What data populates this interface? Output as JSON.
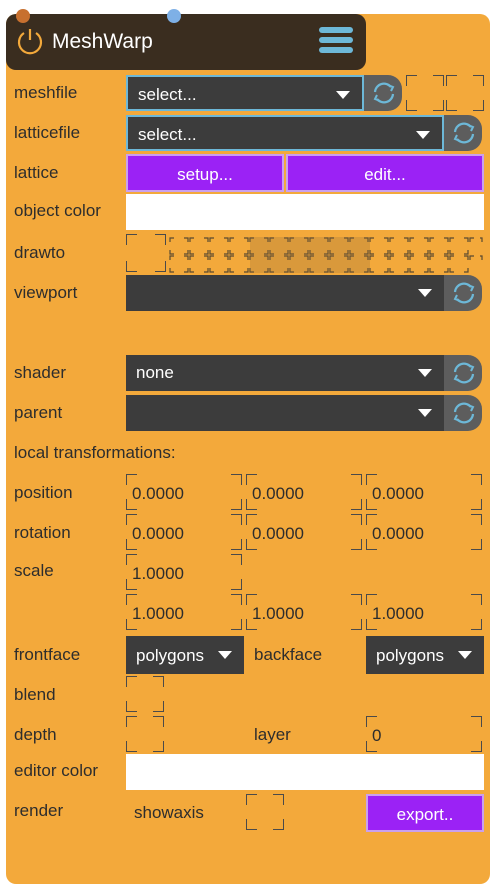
{
  "app": {
    "title": "MeshWarp"
  },
  "colors": {
    "panel": "#f3a93b",
    "titlebar": "#3a2d1f",
    "accent_purple": "#9b22f5",
    "dropdown": "#3c3c3c",
    "refresh_icon": "#6db8d8"
  },
  "rows": {
    "meshfile": {
      "label": "meshfile",
      "value": "select..."
    },
    "latticefile": {
      "label": "latticefile",
      "value": "select..."
    },
    "lattice": {
      "label": "lattice",
      "setup": "setup...",
      "edit": "edit..."
    },
    "object_color": {
      "label": "object color"
    },
    "drawto": {
      "label": "drawto"
    },
    "viewport": {
      "label": "viewport",
      "value": ""
    },
    "shader": {
      "label": "shader",
      "value": "none"
    },
    "parent": {
      "label": "parent",
      "value": ""
    },
    "local": {
      "label": "local transformations:"
    },
    "position": {
      "label": "position",
      "values": [
        "0.0000",
        "0.0000",
        "0.0000"
      ]
    },
    "rotation": {
      "label": "rotation",
      "values": [
        "0.0000",
        "0.0000",
        "0.0000"
      ]
    },
    "scale": {
      "label": "scale",
      "uniform": "1.0000",
      "values": [
        "1.0000",
        "1.0000",
        "1.0000"
      ]
    },
    "frontface": {
      "label": "frontface",
      "value": "polygons"
    },
    "backface": {
      "label": "backface",
      "value": "polygons"
    },
    "blend": {
      "label": "blend"
    },
    "depth": {
      "label": "depth"
    },
    "layer": {
      "label": "layer",
      "value": "0"
    },
    "editor_color": {
      "label": "editor color"
    },
    "render": {
      "label": "render",
      "showaxis": "showaxis",
      "export": "export.."
    }
  },
  "icons": {
    "power": "power-icon",
    "menu": "hamburger-menu-icon",
    "refresh": "refresh-icon"
  }
}
